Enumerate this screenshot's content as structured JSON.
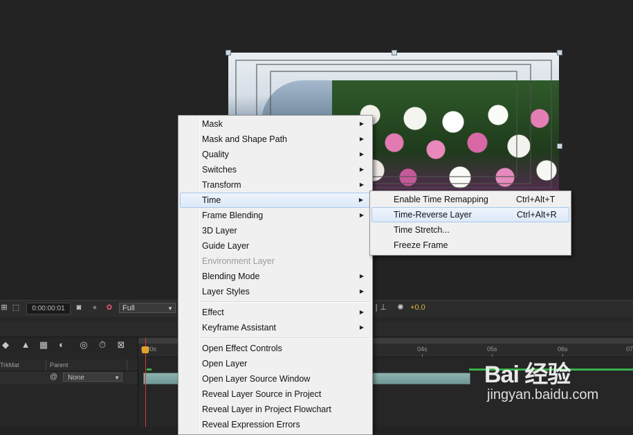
{
  "viewer_toolbar": {
    "timecode": "0:00:00:01",
    "resolution": "Full",
    "exposure": "+0.0"
  },
  "timeline": {
    "ruler_labels": [
      "04s",
      "05s",
      "06s",
      "07"
    ],
    "ruler_start": "0:00s",
    "columns": {
      "trkmat": "TrkMat",
      "parent": "Parent"
    },
    "parent_value": "None"
  },
  "context_menu": {
    "items": [
      {
        "label": "Mask",
        "submenu": true
      },
      {
        "label": "Mask and Shape Path",
        "submenu": true
      },
      {
        "label": "Quality",
        "submenu": true
      },
      {
        "label": "Switches",
        "submenu": true
      },
      {
        "label": "Transform",
        "submenu": true
      },
      {
        "label": "Time",
        "submenu": true,
        "highlighted": true
      },
      {
        "label": "Frame Blending",
        "submenu": true
      },
      {
        "label": "3D Layer"
      },
      {
        "label": "Guide Layer"
      },
      {
        "label": "Environment Layer",
        "disabled": true
      },
      {
        "label": "Blending Mode",
        "submenu": true
      },
      {
        "label": "Layer Styles",
        "submenu": true
      },
      {
        "label": "Effect",
        "submenu": true
      },
      {
        "label": "Keyframe Assistant",
        "submenu": true
      },
      {
        "label": "Open Effect Controls"
      },
      {
        "label": "Open Layer"
      },
      {
        "label": "Open Layer Source Window"
      },
      {
        "label": "Reveal Layer Source in Project"
      },
      {
        "label": "Reveal Layer in Project Flowchart"
      },
      {
        "label": "Reveal Expression Errors"
      }
    ]
  },
  "time_submenu": {
    "items": [
      {
        "label": "Enable Time Remapping",
        "shortcut": "Ctrl+Alt+T"
      },
      {
        "label": "Time-Reverse Layer",
        "shortcut": "Ctrl+Alt+R",
        "highlighted": true
      },
      {
        "label": "Time Stretch...",
        "shortcut": ""
      },
      {
        "label": "Freeze Frame",
        "shortcut": ""
      }
    ]
  },
  "watermark": {
    "logo": "Bai  经验",
    "site": "jingyan.baidu.com"
  }
}
